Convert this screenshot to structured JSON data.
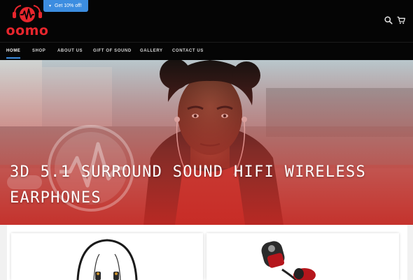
{
  "promo": {
    "label": "Get 10% off!",
    "caret": "▾"
  },
  "brand": {
    "name": "oomo",
    "color": "#e8262d"
  },
  "header": {
    "icons": [
      "search-icon",
      "cart-icon"
    ]
  },
  "nav": {
    "items": [
      {
        "label": "HOME",
        "active": true
      },
      {
        "label": "SHOP"
      },
      {
        "label": "ABOUT US"
      },
      {
        "label": "GIFT OF SOUND"
      },
      {
        "label": "GALLERY"
      },
      {
        "label": "CONTACT US"
      }
    ]
  },
  "hero": {
    "title": "3D 5.1 SURROUND SOUND HIFI WIRELESS EARPHONES"
  },
  "products": {
    "cards": [
      {
        "image": "neckband-earphones"
      },
      {
        "image": "red-earbuds"
      }
    ]
  },
  "colors": {
    "header_bg": "#050505",
    "accent": "#3c8de0",
    "brand_red": "#e8262d"
  }
}
